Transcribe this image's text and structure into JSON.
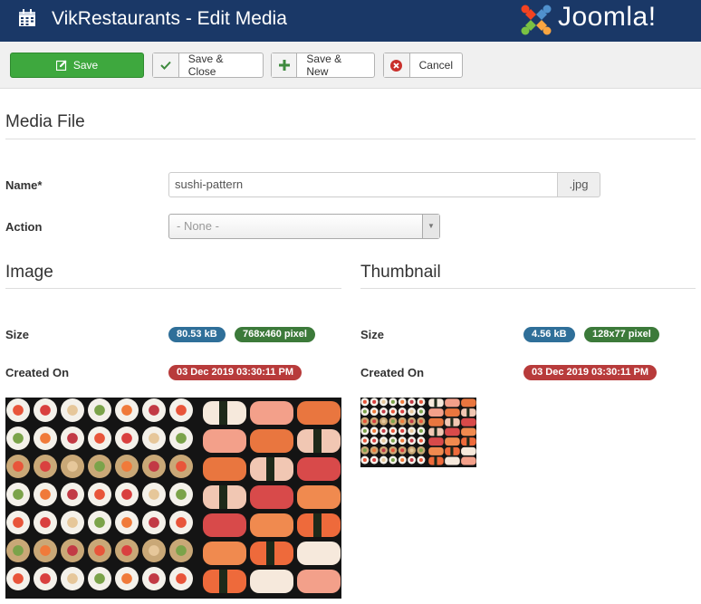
{
  "header": {
    "title": "VikRestaurants - Edit Media",
    "brand": "Joomla!",
    "bg_color": "#1a3867"
  },
  "toolbar": {
    "save": "Save",
    "save_close": "Save & Close",
    "save_new": "Save & New",
    "cancel": "Cancel"
  },
  "media_file": {
    "heading": "Media File",
    "name_label": "Name*",
    "name_value": "sushi-pattern",
    "extension": ".jpg",
    "action_label": "Action",
    "action_value": "- None -"
  },
  "image": {
    "heading": "Image",
    "size_label": "Size",
    "size": "80.53 kB",
    "dimensions": "768x460 pixel",
    "created_label": "Created On",
    "created": "03 Dec 2019 03:30:11 PM"
  },
  "thumbnail": {
    "heading": "Thumbnail",
    "size_label": "Size",
    "size": "4.56 kB",
    "dimensions": "128x77 pixel",
    "created_label": "Created On",
    "created": "03 Dec 2019 03:30:11 PM"
  },
  "colors": {
    "save_green": "#3ea83e",
    "badge_blue": "#2f6f99",
    "badge_green": "#3c7a3a",
    "badge_red": "#b83b3b"
  }
}
